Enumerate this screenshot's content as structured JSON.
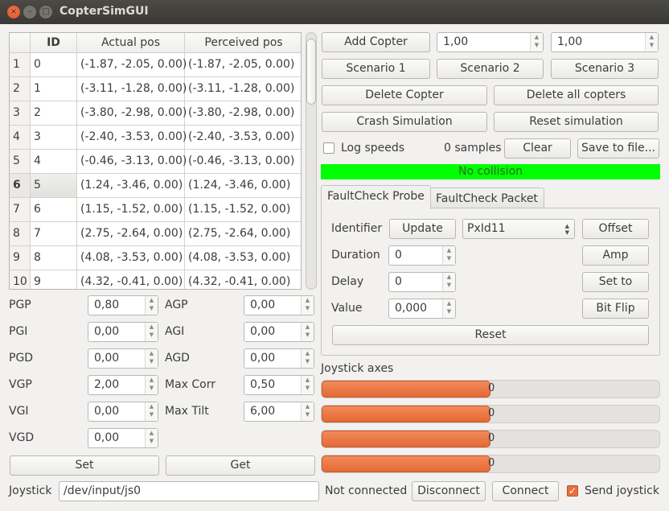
{
  "window": {
    "title": "CopterSimGUI",
    "controls": {
      "close": "×",
      "minimize": "–",
      "maximize": "□"
    }
  },
  "table": {
    "headers": [
      "",
      "ID",
      "Actual pos",
      "Perceived pos"
    ],
    "rows": [
      {
        "num": "1",
        "id": "0",
        "actual": "(-1.87, -2.05, 0.00)",
        "perceived": "(-1.87, -2.05, 0.00)"
      },
      {
        "num": "2",
        "id": "1",
        "actual": "(-3.11, -1.28, 0.00)",
        "perceived": "(-3.11, -1.28, 0.00)"
      },
      {
        "num": "3",
        "id": "2",
        "actual": "(-3.80, -2.98, 0.00)",
        "perceived": "(-3.80, -2.98, 0.00)"
      },
      {
        "num": "4",
        "id": "3",
        "actual": "(-2.40, -3.53, 0.00)",
        "perceived": "(-2.40, -3.53, 0.00)"
      },
      {
        "num": "5",
        "id": "4",
        "actual": "(-0.46, -3.13, 0.00)",
        "perceived": "(-0.46, -3.13, 0.00)"
      },
      {
        "num": "6",
        "id": "5",
        "actual": "(1.24, -3.46, 0.00)",
        "perceived": "(1.24, -3.46, 0.00)"
      },
      {
        "num": "7",
        "id": "6",
        "actual": "(1.15, -1.52, 0.00)",
        "perceived": "(1.15, -1.52, 0.00)"
      },
      {
        "num": "8",
        "id": "7",
        "actual": "(2.75, -2.64, 0.00)",
        "perceived": "(2.75, -2.64, 0.00)"
      },
      {
        "num": "9",
        "id": "8",
        "actual": "(4.08, -3.53, 0.00)",
        "perceived": "(4.08, -3.53, 0.00)"
      },
      {
        "num": "10",
        "id": "9",
        "actual": "(4.32, -0.41, 0.00)",
        "perceived": "(4.32, -0.41, 0.00)"
      }
    ],
    "selected_row": "6"
  },
  "gains": {
    "pgp": {
      "label": "PGP",
      "value": "0,80"
    },
    "pgi": {
      "label": "PGI",
      "value": "0,00"
    },
    "pgd": {
      "label": "PGD",
      "value": "0,00"
    },
    "vgp": {
      "label": "VGP",
      "value": "2,00"
    },
    "vgi": {
      "label": "VGI",
      "value": "0,00"
    },
    "vgd": {
      "label": "VGD",
      "value": "0,00"
    },
    "agp": {
      "label": "AGP",
      "value": "0,00"
    },
    "agi": {
      "label": "AGI",
      "value": "0,00"
    },
    "agd": {
      "label": "AGD",
      "value": "0,00"
    },
    "max_corr": {
      "label": "Max Corr",
      "value": "0,50"
    },
    "max_tilt": {
      "label": "Max Tilt",
      "value": "6,00"
    },
    "set_label": "Set",
    "get_label": "Get"
  },
  "joystick": {
    "label": "Joystick",
    "device": "/dev/input/js0",
    "status": "Not connected",
    "disconnect_label": "Disconnect",
    "connect_label": "Connect",
    "send_label": "Send joystick",
    "send_checked": true,
    "axes_label": "Joystick axes",
    "axes": [
      {
        "text": "0",
        "fill_fraction": 0.5
      },
      {
        "text": "0",
        "fill_fraction": 0.5
      },
      {
        "text": "0",
        "fill_fraction": 0.5
      },
      {
        "text": "0",
        "fill_fraction": 0.5
      }
    ]
  },
  "controls": {
    "add_copter_label": "Add Copter",
    "spin_x": "1,00",
    "spin_y": "1,00",
    "scenario1_label": "Scenario 1",
    "scenario2_label": "Scenario 2",
    "scenario3_label": "Scenario 3",
    "delete_copter_label": "Delete Copter",
    "delete_all_label": "Delete all copters",
    "crash_label": "Crash Simulation",
    "reset_sim_label": "Reset simulation",
    "log_speeds_label": "Log speeds",
    "log_speeds_checked": false,
    "samples": "0 samples",
    "clear_label": "Clear",
    "save_label": "Save to file..."
  },
  "collision": {
    "text": "No collision",
    "color": "#00ff00"
  },
  "faultcheck": {
    "tabs": [
      "FaultCheck Probe",
      "FaultCheck Packet"
    ],
    "active_tab": 0,
    "identifier_label": "Identifier",
    "update_label": "Update",
    "identifier_value": "PxId11",
    "offset_label": "Offset",
    "duration_label": "Duration",
    "duration_value": "0",
    "amp_label": "Amp",
    "delay_label": "Delay",
    "delay_value": "0",
    "set_to_label": "Set to",
    "value_label": "Value",
    "value_value": "0,000",
    "bit_flip_label": "Bit Flip",
    "reset_label": "Reset"
  },
  "colors": {
    "accent": "#e8713d",
    "titlebar": "#3e3d39",
    "window_bg": "#f2f1f0"
  }
}
